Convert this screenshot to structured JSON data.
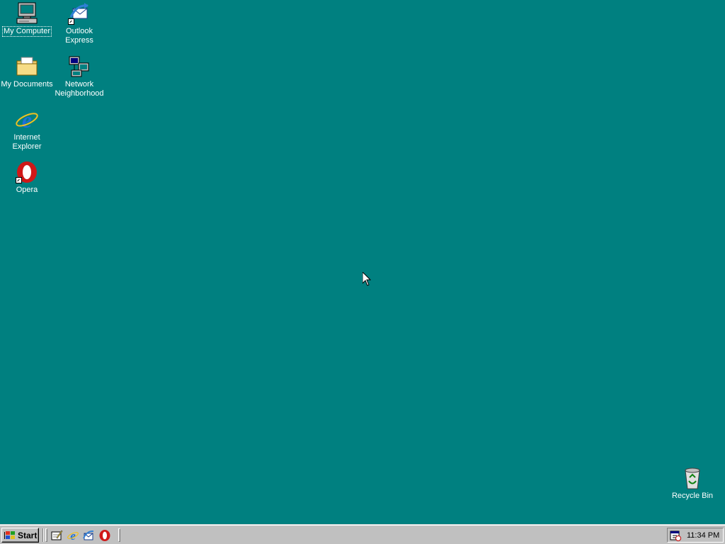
{
  "desktop": {
    "background": "#008080",
    "icons": [
      {
        "label": "My Computer",
        "icon": "my-computer-icon",
        "selected": true
      },
      {
        "label": "Outlook Express",
        "icon": "outlook-express-icon",
        "shortcut": true
      },
      {
        "label": "My Documents",
        "icon": "my-documents-folder-icon"
      },
      {
        "label": "Network Neighborhood",
        "icon": "network-neighborhood-icon"
      },
      {
        "label": "Internet Explorer",
        "icon": "internet-explorer-icon"
      },
      {
        "label": "Opera",
        "icon": "opera-icon",
        "shortcut": true
      },
      {
        "label": "Recycle Bin",
        "icon": "recycle-bin-icon"
      }
    ]
  },
  "taskbar": {
    "start_label": "Start",
    "quick_launch": [
      {
        "icon": "show-desktop-icon"
      },
      {
        "icon": "internet-explorer-icon"
      },
      {
        "icon": "outlook-express-icon"
      },
      {
        "icon": "opera-icon"
      }
    ],
    "tray": {
      "icon": "task-scheduler-icon",
      "time": "11:34 PM"
    }
  }
}
